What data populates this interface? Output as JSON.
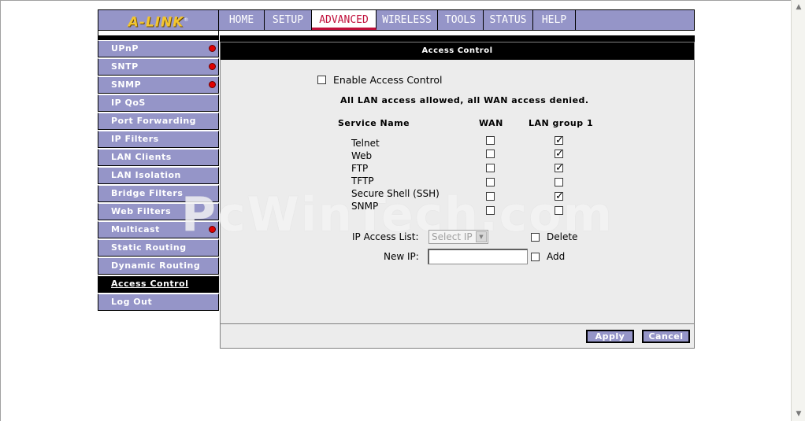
{
  "brand": {
    "logo": "A-LINK",
    "logo_mark": "®"
  },
  "nav": {
    "tabs": [
      "HOME",
      "SETUP",
      "ADVANCED",
      "WIRELESS",
      "TOOLS",
      "STATUS",
      "HELP"
    ],
    "active": "ADVANCED"
  },
  "sidebar": {
    "items": [
      {
        "label": "UPnP",
        "dot": true
      },
      {
        "label": "SNTP",
        "dot": true
      },
      {
        "label": "SNMP",
        "dot": true
      },
      {
        "label": "IP QoS",
        "dot": false
      },
      {
        "label": "Port Forwarding",
        "dot": false
      },
      {
        "label": "IP Filters",
        "dot": false
      },
      {
        "label": "LAN Clients",
        "dot": false
      },
      {
        "label": "LAN Isolation",
        "dot": false
      },
      {
        "label": "Bridge Filters",
        "dot": false
      },
      {
        "label": "Web Filters",
        "dot": false
      },
      {
        "label": "Multicast",
        "dot": true
      },
      {
        "label": "Static Routing",
        "dot": false
      },
      {
        "label": "Dynamic Routing",
        "dot": false
      },
      {
        "label": "Access Control",
        "dot": false,
        "active": true
      },
      {
        "label": "Log Out",
        "dot": false
      }
    ]
  },
  "panel": {
    "title": "Access Control",
    "enable_label": "Enable Access Control",
    "enable_checked": false,
    "status": "All LAN access allowed, all WAN access denied.",
    "columns": {
      "service": "Service Name",
      "wan": "WAN",
      "lan": "LAN group 1"
    },
    "services": [
      {
        "name": "Telnet",
        "wan": false,
        "lan": true
      },
      {
        "name": "Web",
        "wan": false,
        "lan": true
      },
      {
        "name": "FTP",
        "wan": false,
        "lan": true
      },
      {
        "name": "TFTP",
        "wan": false,
        "lan": false
      },
      {
        "name": "Secure Shell (SSH)",
        "wan": false,
        "lan": true
      },
      {
        "name": "SNMP",
        "wan": false,
        "lan": false
      }
    ],
    "ip_access_label": "IP Access List:",
    "ip_select_value": "Select IP",
    "delete_label": "Delete",
    "new_ip_label": "New IP:",
    "new_ip_value": "",
    "add_label": "Add"
  },
  "buttons": {
    "apply": "Apply",
    "cancel": "Cancel"
  },
  "watermark": "PcWinTech.com",
  "colors": {
    "menu_bg": "#9595c8",
    "active_tab_text": "#c0103a",
    "dot": "#e00000"
  }
}
